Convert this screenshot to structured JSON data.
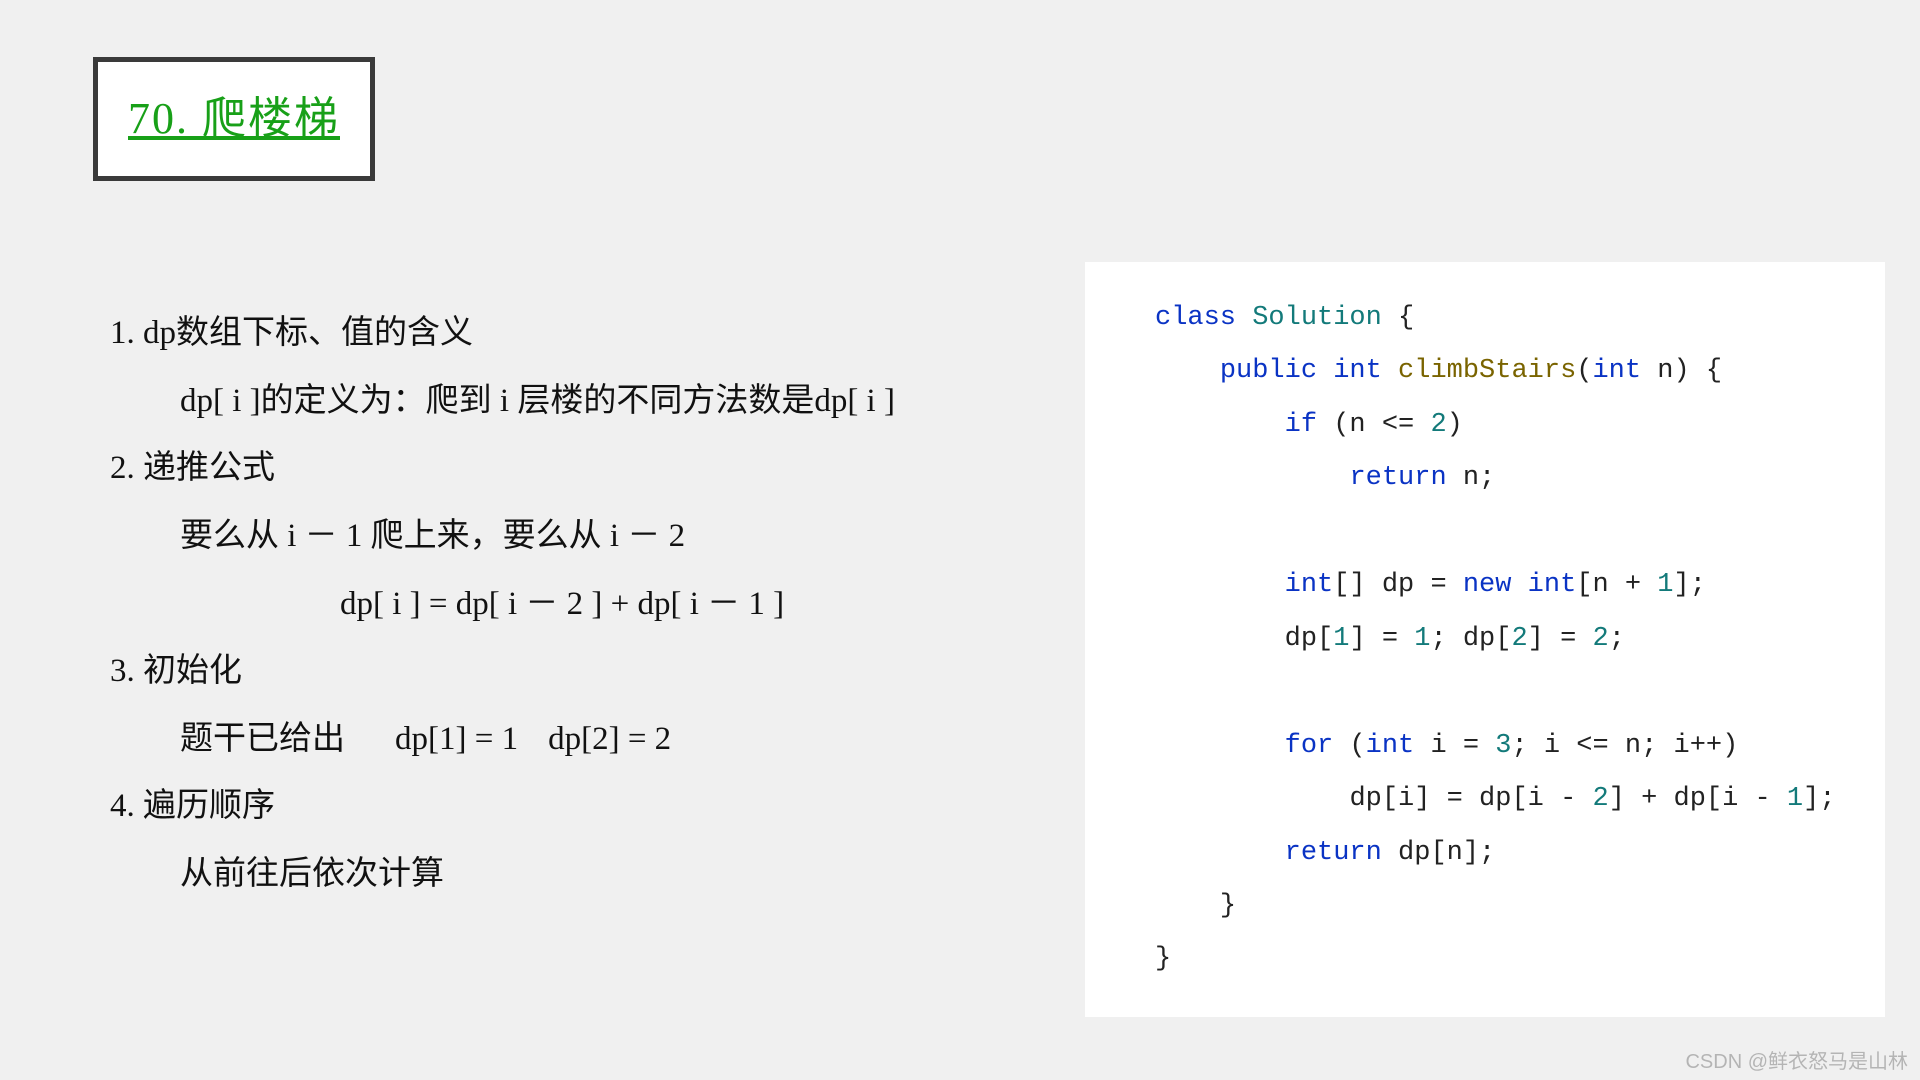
{
  "title": "70. 爬楼梯",
  "notes": {
    "h1": "1. dp数组下标、值的含义",
    "l1": "dp[ i ]的定义为：爬到 i 层楼的不同方法数是dp[ i ]",
    "h2": "2. 递推公式",
    "l2a": "要么从 i － 1 爬上来，要么从 i － 2",
    "l2b": "dp[ i ] = dp[ i － 2 ] + dp[ i － 1 ]",
    "h3": "3. 初始化",
    "l3a": "题干已给出",
    "l3b": "dp[1] = 1",
    "l3c": "dp[2] = 2",
    "h4": "4. 遍历顺序",
    "l4": "从前往后依次计算"
  },
  "code": {
    "kw_class": "class",
    "cls": "Solution",
    "open1": " {",
    "kw_public": "public",
    "ty_int": "int",
    "fn": "climbStairs",
    "sig_open": "(",
    "param_n": "n",
    "sig_close": ") {",
    "kw_if": "if",
    "cond": " (n <= ",
    "two": "2",
    "cond_close": ")",
    "kw_return1": "return",
    "ret_n": " n;",
    "arr_decl1": "[] dp = ",
    "kw_new": "new",
    "arr_decl2": "[n + ",
    "one": "1",
    "arr_decl3": "];",
    "init1": "dp[",
    "init1b": "] = ",
    "init_semi": "; dp[",
    "init2b": "] = ",
    "init_end": ";",
    "kw_for": "for",
    "for_open": " (",
    "for_i": " i = ",
    "three": "3",
    "for_cond": "; i <= n; i++)",
    "loop_body": "dp[i] = dp[i - ",
    "loop_body2": "] + dp[i - ",
    "loop_body3": "];",
    "kw_return2": "return",
    "ret_dp": " dp[n];",
    "close_inner": "}",
    "close_outer": "}"
  },
  "watermark": "CSDN @鲜衣怒马是山林"
}
